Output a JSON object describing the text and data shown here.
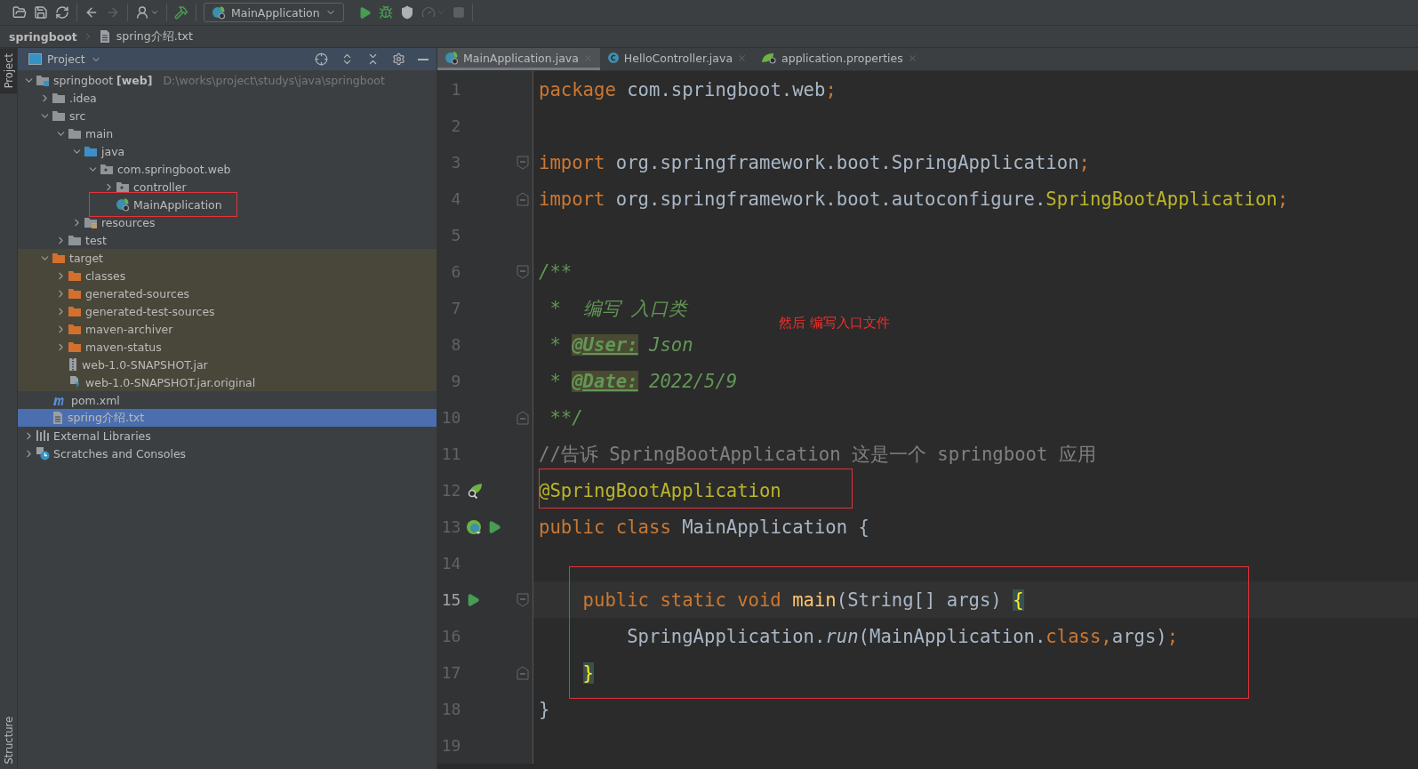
{
  "toolbar": {
    "groups": [
      {
        "buttons": [
          {
            "kind": "open",
            "disabled": false
          },
          {
            "kind": "save",
            "disabled": false
          },
          {
            "kind": "sync",
            "disabled": false
          }
        ]
      },
      {
        "buttons": [
          {
            "kind": "back",
            "disabled": false
          },
          {
            "kind": "forward",
            "disabled": true
          }
        ]
      },
      {
        "buttons": [
          {
            "kind": "vcs-user",
            "disabled": false
          }
        ]
      },
      {
        "buttons": [
          {
            "kind": "build",
            "disabled": false
          }
        ]
      }
    ],
    "run_config": {
      "label": "MainApplication"
    },
    "actions": [
      {
        "kind": "run",
        "disabled": false
      },
      {
        "kind": "debug",
        "disabled": false
      },
      {
        "kind": "coverage",
        "disabled": false
      },
      {
        "kind": "profile",
        "disabled": true
      },
      {
        "kind": "stop",
        "disabled": true
      }
    ]
  },
  "breadcrumb": {
    "project": "springboot",
    "file": "spring介绍.txt"
  },
  "side_stripe": {
    "top": "Project",
    "bottom": "Structure"
  },
  "project_panel": {
    "title": "Project",
    "tree": [
      {
        "label": "springboot **[web]**",
        "path": "D:\\works\\project\\studys\\java\\springboot",
        "kind": "module",
        "expanded": true,
        "selected": false,
        "excluded": false,
        "marked": false,
        "children": [
          {
            "label": ".idea",
            "kind": "folder",
            "expanded": false,
            "selected": false,
            "excluded": false,
            "marked": false
          },
          {
            "label": "src",
            "kind": "folder",
            "expanded": true,
            "selected": false,
            "excluded": false,
            "marked": false,
            "children": [
              {
                "label": "main",
                "kind": "folder",
                "expanded": true,
                "selected": false,
                "excluded": false,
                "marked": false,
                "children": [
                  {
                    "label": "java",
                    "kind": "source-folder",
                    "expanded": true,
                    "selected": false,
                    "excluded": false,
                    "marked": false,
                    "children": [
                      {
                        "label": "com.springboot.web",
                        "kind": "package",
                        "expanded": true,
                        "selected": false,
                        "excluded": false,
                        "marked": false,
                        "children": [
                          {
                            "label": "controller",
                            "kind": "package",
                            "expanded": false,
                            "selected": false,
                            "excluded": false,
                            "marked": false
                          },
                          {
                            "label": "MainApplication",
                            "kind": "spring-class",
                            "selected": false,
                            "excluded": false,
                            "marked": true
                          }
                        ]
                      }
                    ]
                  },
                  {
                    "label": "resources",
                    "kind": "resources",
                    "expanded": false,
                    "selected": false,
                    "excluded": false,
                    "marked": false
                  }
                ]
              },
              {
                "label": "test",
                "kind": "folder",
                "expanded": false,
                "selected": false,
                "excluded": false,
                "marked": false
              }
            ]
          },
          {
            "label": "target",
            "kind": "excluded-folder",
            "expanded": true,
            "selected": false,
            "excluded": true,
            "marked": false,
            "children": [
              {
                "label": "classes",
                "kind": "excluded-folder",
                "expanded": false,
                "selected": false,
                "excluded": true,
                "marked": false
              },
              {
                "label": "generated-sources",
                "kind": "excluded-folder",
                "expanded": false,
                "selected": false,
                "excluded": true,
                "marked": false
              },
              {
                "label": "generated-test-sources",
                "kind": "excluded-folder",
                "expanded": false,
                "selected": false,
                "excluded": true,
                "marked": false
              },
              {
                "label": "maven-archiver",
                "kind": "excluded-folder",
                "expanded": false,
                "selected": false,
                "excluded": true,
                "marked": false
              },
              {
                "label": "maven-status",
                "kind": "excluded-folder",
                "expanded": false,
                "selected": false,
                "excluded": true,
                "marked": false
              },
              {
                "label": "web-1.0-SNAPSHOT.jar",
                "kind": "jar",
                "selected": false,
                "excluded": true,
                "marked": false
              },
              {
                "label": "web-1.0-SNAPSHOT.jar.original",
                "kind": "unknown-file",
                "selected": false,
                "excluded": true,
                "marked": false
              }
            ]
          },
          {
            "label": "pom.xml",
            "kind": "maven",
            "selected": false,
            "excluded": false,
            "marked": false
          },
          {
            "label": "spring介绍.txt",
            "kind": "text-file",
            "selected": true,
            "excluded": false,
            "marked": false
          }
        ]
      },
      {
        "label": "External Libraries",
        "kind": "libraries",
        "expanded": false,
        "selected": false,
        "excluded": false,
        "marked": false
      },
      {
        "label": "Scratches and Consoles",
        "kind": "scratches",
        "expanded": false,
        "selected": false,
        "excluded": false,
        "marked": false
      }
    ]
  },
  "tabs": [
    {
      "label": "MainApplication.java",
      "kind": "spring-class",
      "selected": true
    },
    {
      "label": "HelloController.java",
      "kind": "class",
      "selected": false
    },
    {
      "label": "application.properties",
      "kind": "spring-config",
      "selected": false
    }
  ],
  "editor": {
    "note": "然后 编写入口文件",
    "lines": [
      {
        "number": "1",
        "current": false,
        "framed": false,
        "tokens": [
          {
            "kind": "keyword",
            "text": "package "
          },
          {
            "kind": "plain",
            "text": "com.springboot.web"
          },
          {
            "kind": "keyword",
            "text": ";"
          }
        ]
      },
      {
        "number": "2",
        "current": false,
        "framed": false
      },
      {
        "number": "3",
        "current": false,
        "framed": false,
        "fold": {
          "kind": "start"
        },
        "tokens": [
          {
            "kind": "keyword",
            "text": "import "
          },
          {
            "kind": "plain",
            "text": "org.springframework.boot.SpringApplication"
          },
          {
            "kind": "keyword",
            "text": ";"
          }
        ]
      },
      {
        "number": "4",
        "current": false,
        "framed": false,
        "fold": {
          "kind": "end"
        },
        "tokens": [
          {
            "kind": "keyword",
            "text": "import "
          },
          {
            "kind": "plain",
            "text": "org.springframework.boot.autoconfigure."
          },
          {
            "kind": "annotation",
            "text": "SpringBootApplication"
          },
          {
            "kind": "keyword",
            "text": ";"
          }
        ]
      },
      {
        "number": "5",
        "current": false,
        "framed": false
      },
      {
        "number": "6",
        "current": false,
        "framed": false,
        "fold": {
          "kind": "start"
        },
        "tokens": [
          {
            "kind": "doc",
            "text": "/**"
          }
        ]
      },
      {
        "number": "7",
        "current": false,
        "framed": false,
        "tokens": [
          {
            "kind": "doc",
            "text": " *  编写 入口类"
          }
        ]
      },
      {
        "number": "8",
        "current": false,
        "framed": false,
        "tokens": [
          {
            "kind": "doc",
            "text": " * "
          },
          {
            "kind": "doc-tag",
            "text": "@User:"
          },
          {
            "kind": "doc",
            "text": " Json"
          }
        ]
      },
      {
        "number": "9",
        "current": false,
        "framed": false,
        "tokens": [
          {
            "kind": "doc",
            "text": " * "
          },
          {
            "kind": "doc-tag",
            "text": "@Date:"
          },
          {
            "kind": "doc",
            "text": " 2022/5/9"
          }
        ]
      },
      {
        "number": "10",
        "current": false,
        "framed": false,
        "fold": {
          "kind": "end"
        },
        "tokens": [
          {
            "kind": "doc",
            "text": " **/"
          }
        ]
      },
      {
        "number": "11",
        "current": false,
        "framed": false,
        "tokens": [
          {
            "kind": "comment",
            "text": "//告诉 SpringBootApplication 这是一个 springboot 应用"
          }
        ]
      },
      {
        "number": "12",
        "current": false,
        "framed": true,
        "gutter": [
          {
            "kind": "bean-search"
          }
        ],
        "tokens": [
          {
            "kind": "annotation",
            "text": "@SpringBootApplication"
          }
        ]
      },
      {
        "number": "13",
        "current": false,
        "framed": false,
        "gutter": [
          {
            "kind": "bean"
          },
          {
            "kind": "run"
          }
        ],
        "tokens": [
          {
            "kind": "keyword",
            "text": "public class "
          },
          {
            "kind": "plain",
            "text": "MainApplication {"
          }
        ]
      },
      {
        "number": "14",
        "current": false,
        "framed": false
      },
      {
        "number": "15",
        "current": true,
        "framed": true,
        "indented": true,
        "gutter": [
          {
            "kind": "run"
          }
        ],
        "fold": {
          "kind": "start"
        },
        "tokens": [
          {
            "kind": "keyword",
            "text": "public static void "
          },
          {
            "kind": "method",
            "text": "main"
          },
          {
            "kind": "plain",
            "text": "(String[] args) "
          },
          {
            "kind": "brace",
            "text": "{"
          }
        ]
      },
      {
        "number": "16",
        "current": false,
        "framed": true,
        "indented": true,
        "tokens": [
          {
            "kind": "plain",
            "text": "    SpringApplication."
          },
          {
            "kind": "static",
            "text": "run"
          },
          {
            "kind": "plain",
            "text": "(MainApplication."
          },
          {
            "kind": "keyword",
            "text": "class,"
          },
          {
            "kind": "plain",
            "text": "args)"
          },
          {
            "kind": "keyword",
            "text": ";"
          }
        ]
      },
      {
        "number": "17",
        "current": false,
        "framed": true,
        "indented": true,
        "fold": {
          "kind": "end"
        },
        "tokens": [
          {
            "kind": "brace",
            "text": "}"
          }
        ]
      },
      {
        "number": "18",
        "current": false,
        "framed": false,
        "tokens": [
          {
            "kind": "plain",
            "text": "}"
          }
        ]
      },
      {
        "number": "19",
        "current": false,
        "framed": false
      }
    ]
  }
}
